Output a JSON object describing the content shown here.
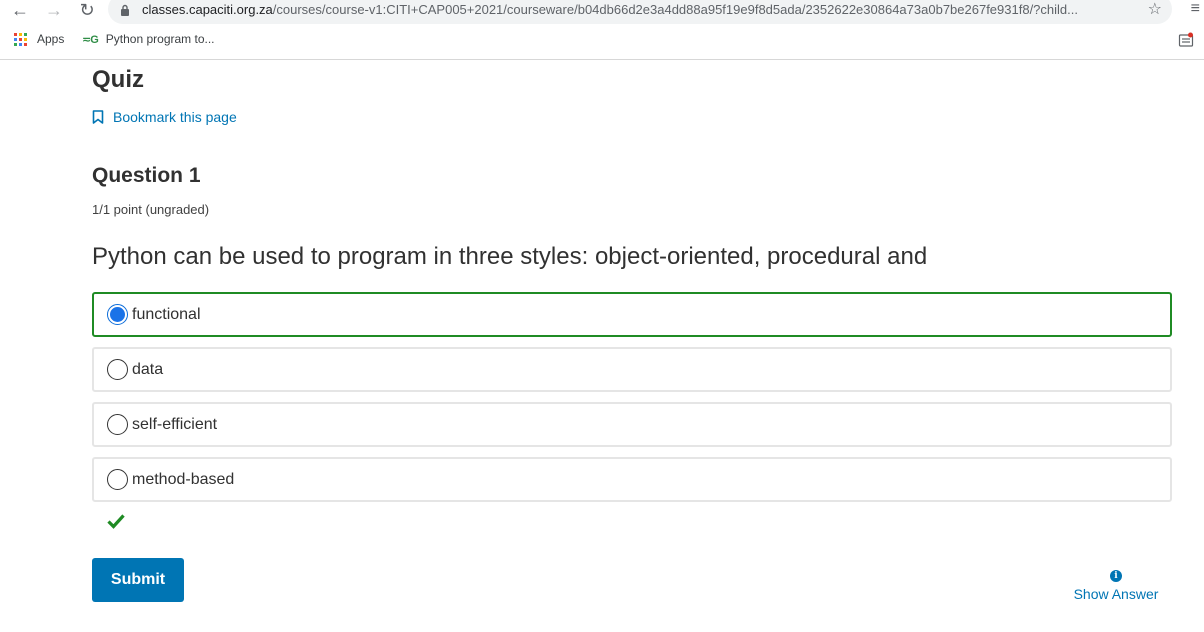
{
  "browser": {
    "url_host": "classes.capaciti.org.za",
    "url_path": "/courses/course-v1:CITI+CAP005+2021/courseware/b04db66d2e3a4dd88a95f19e9f8d5ada/2352622e30864a73a0b7be267fe931f8/?child...",
    "bookmarks": [
      {
        "label": "Apps",
        "icon": "apps-grid-icon"
      },
      {
        "label": "Python program to...",
        "icon": "geeksforgeeks-icon"
      }
    ]
  },
  "page": {
    "title": "Quiz",
    "bookmark_label": "Bookmark this page"
  },
  "question": {
    "title": "Question 1",
    "points": "1/1 point (ungraded)",
    "prompt": "Python can be used to program in three styles: object-oriented, procedural and",
    "choices": [
      {
        "label": "functional",
        "selected": true,
        "correct": true
      },
      {
        "label": "data",
        "selected": false
      },
      {
        "label": "self-efficient",
        "selected": false
      },
      {
        "label": "method-based",
        "selected": false
      }
    ],
    "status_icon": "checkmark-icon"
  },
  "actions": {
    "submit_label": "Submit",
    "show_answer_label": "Show Answer",
    "show_answer_icon": "info-icon"
  },
  "colors": {
    "link": "#0075b4",
    "correct": "#1f8b24",
    "radio_selected": "#1a73e8"
  }
}
